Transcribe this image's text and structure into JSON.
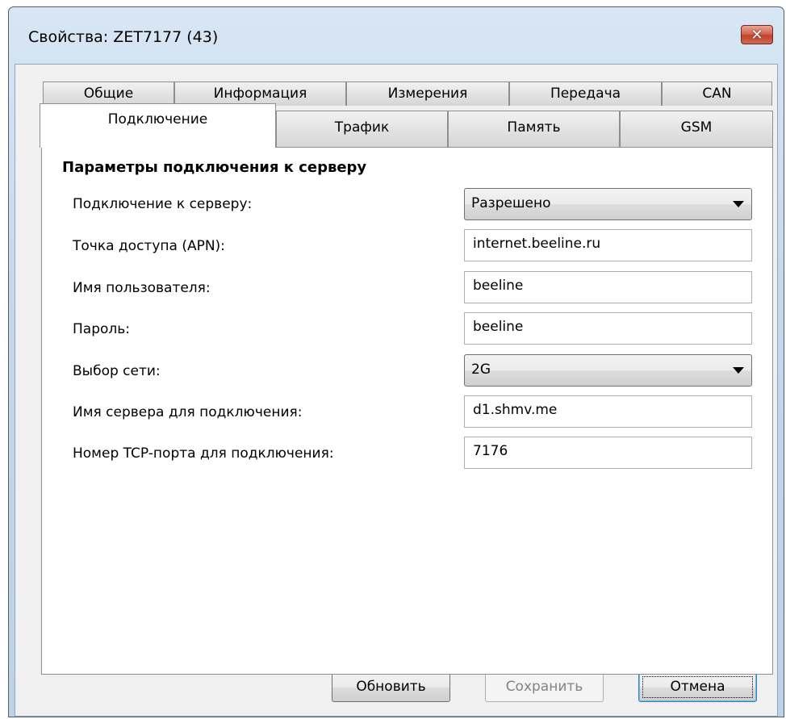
{
  "window": {
    "title": "Свойства: ZET7177 (43)",
    "close_label": "✕"
  },
  "tabs": {
    "row1": [
      "Общие",
      "Информация",
      "Измерения",
      "Передача",
      "CAN"
    ],
    "row2": [
      "Подключение",
      "Трафик",
      "Память",
      "GSM"
    ],
    "selected": "Подключение"
  },
  "panel": {
    "section_title": "Параметры подключения к серверу",
    "fields": [
      {
        "label": "Подключение к серверу:",
        "value": "Разрешено",
        "type": "dropdown"
      },
      {
        "label": "Точка доступа (APN):",
        "value": "internet.beeline.ru",
        "type": "text"
      },
      {
        "label": "Имя пользователя:",
        "value": "beeline",
        "type": "text"
      },
      {
        "label": "Пароль:",
        "value": "beeline",
        "type": "text"
      },
      {
        "label": "Выбор сети:",
        "value": "2G",
        "type": "dropdown"
      },
      {
        "label": "Имя сервера для подключения:",
        "value": "d1.shmv.me",
        "type": "text"
      },
      {
        "label": "Номер TCP-порта для подключения:",
        "value": "7176",
        "type": "text"
      }
    ]
  },
  "buttons": {
    "refresh": "Обновить",
    "save": "Сохранить",
    "cancel": "Отмена"
  },
  "colors": {
    "titlebar": "#c5d8ec",
    "close_button": "#c2412a",
    "dialog_background": "#f0f0f0",
    "default_button_border": "#3c7fb1"
  }
}
